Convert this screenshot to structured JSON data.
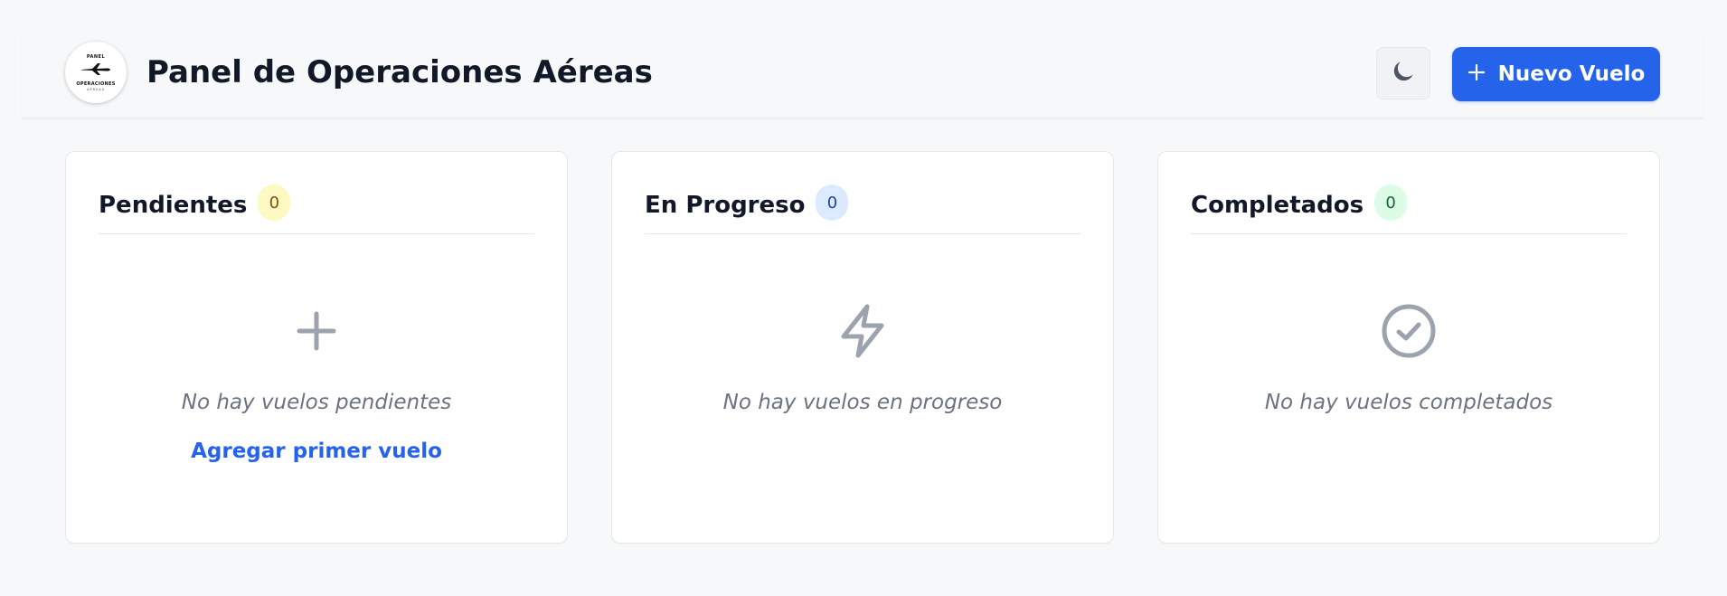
{
  "header": {
    "logo": {
      "top_text": "PANEL",
      "main_text": "OPERACIONES",
      "sub_text": "AÉREAS",
      "icon": "airplane-icon"
    },
    "title": "Panel de Operaciones Aéreas",
    "theme_toggle": {
      "icon": "moon-icon"
    },
    "new_flight_button": {
      "icon": "plus-icon",
      "label": "Nuevo Vuelo"
    }
  },
  "board": {
    "columns": [
      {
        "title": "Pendientes",
        "count": "0",
        "badge_color": "#fef9c3",
        "empty_icon": "plus-icon",
        "empty_text": "No hay vuelos pendientes",
        "action_label": "Agregar primer vuelo"
      },
      {
        "title": "En Progreso",
        "count": "0",
        "badge_color": "#dbeafe",
        "empty_icon": "lightning-icon",
        "empty_text": "No hay vuelos en progreso"
      },
      {
        "title": "Completados",
        "count": "0",
        "badge_color": "#dcfce7",
        "empty_icon": "check-circle-icon",
        "empty_text": "No hay vuelos completados"
      }
    ]
  },
  "colors": {
    "accent": "#2563eb",
    "background": "#f7f8fa",
    "card": "#ffffff",
    "muted_icon": "#9ca3af",
    "muted_text": "#6b7280"
  }
}
